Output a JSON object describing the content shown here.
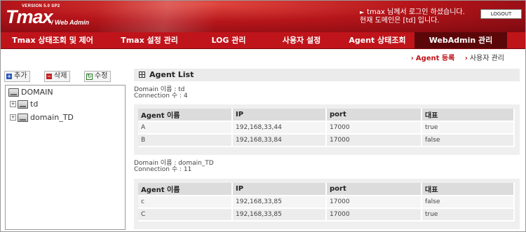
{
  "header": {
    "version": "VERSION 5.0 SP2",
    "logo": "Tmax",
    "logo_sub": "/ Web Admin",
    "login_line1": "tmax 님께서 로그인 하셨습니다.",
    "login_line2": "현재 도메인은 [td] 입니다.",
    "logout_label": "LOGOUT"
  },
  "menu": {
    "items": [
      {
        "label": "Tmax 상태조회 및 제어"
      },
      {
        "label": "Tmax 설정 관리"
      },
      {
        "label": "LOG 관리"
      },
      {
        "label": "사용자 설정"
      },
      {
        "label": "Agent 상태조회"
      },
      {
        "label": "WebAdmin 관리"
      }
    ],
    "active_index": 5
  },
  "subnav": {
    "current": "Agent 등록",
    "other": "사용자 관리"
  },
  "toolbar": {
    "add_label": "추가",
    "delete_label": "삭제",
    "edit_label": "수정"
  },
  "tree": {
    "root": "DOMAIN",
    "children": [
      "td",
      "domain_TD"
    ]
  },
  "panel": {
    "title": "Agent List"
  },
  "domains": [
    {
      "name_line": "Domain 이름 : td",
      "conn_line": "Connection 수 : 4",
      "columns": [
        "Agent 이름",
        "IP",
        "port",
        "대표"
      ],
      "rows": [
        [
          "A",
          "192,168,33,44",
          "17000",
          "true"
        ],
        [
          "B",
          "192,168,33,84",
          "17000",
          "false"
        ]
      ]
    },
    {
      "name_line": "Domain 이름 : domain_TD",
      "conn_line": "Connection 수 : 11",
      "columns": [
        "Agent 이름",
        "IP",
        "port",
        "대표"
      ],
      "rows": [
        [
          "c",
          "192,168,33,85",
          "17000",
          "false"
        ],
        [
          "C",
          "192,168,33,85",
          "17000",
          "true"
        ]
      ]
    }
  ],
  "colors": {
    "brand_red": "#c0141b",
    "active_menu": "#5b0709"
  }
}
